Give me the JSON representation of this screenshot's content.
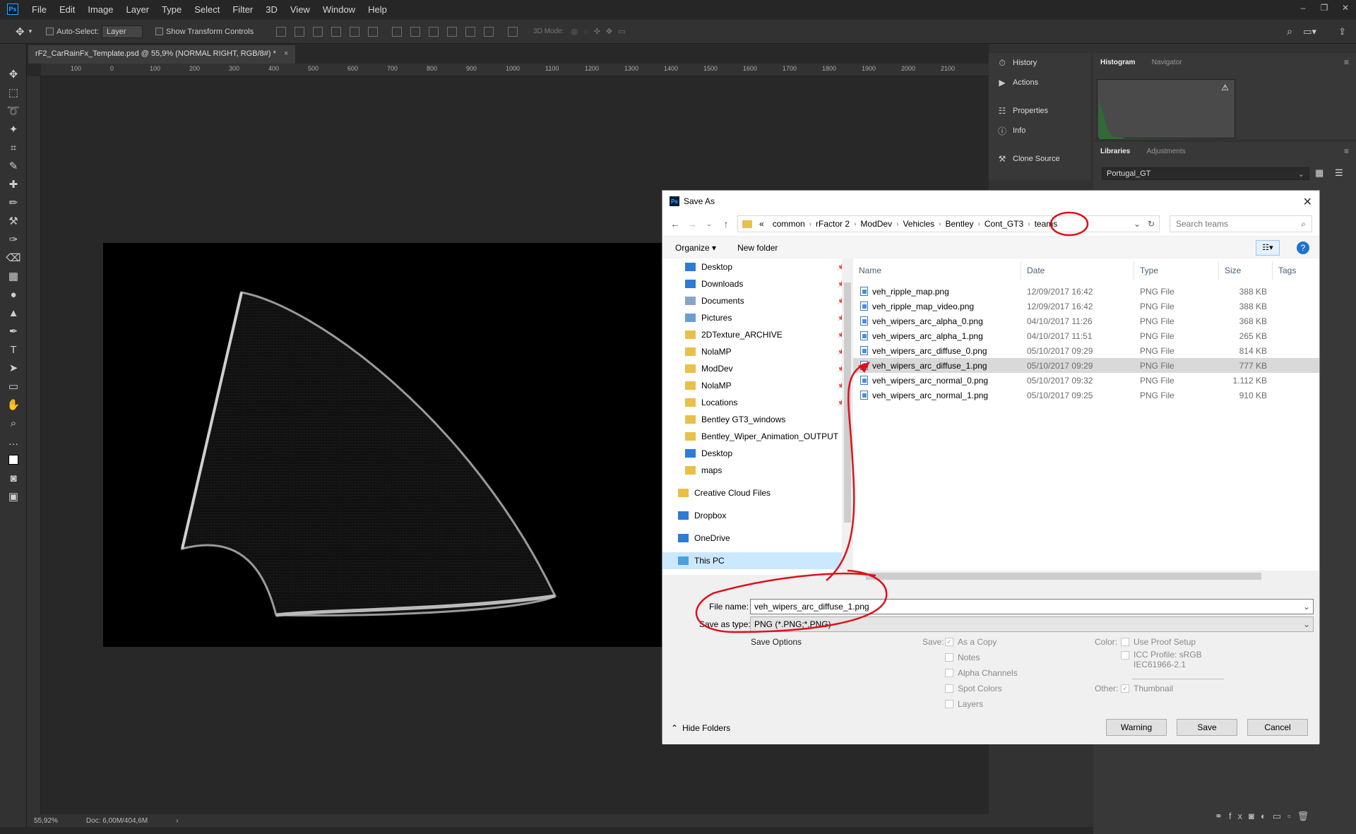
{
  "app": {
    "menu": [
      "File",
      "Edit",
      "Image",
      "Layer",
      "Type",
      "Select",
      "Filter",
      "3D",
      "View",
      "Window",
      "Help"
    ],
    "window_controls": [
      "–",
      "❐",
      "✕"
    ]
  },
  "options_bar": {
    "auto_select_label": "Auto-Select:",
    "auto_select_value": "Layer",
    "show_transform_label": "Show Transform Controls",
    "mode_3d_label": "3D Mode:"
  },
  "document": {
    "tab_title": "rF2_CarRainFx_Template.psd @ 55,9% (NORMAL RIGHT, RGB/8#) *",
    "ruler_labels": [
      "100",
      "0",
      "100",
      "200",
      "300",
      "400",
      "500",
      "600",
      "700",
      "800",
      "900",
      "1000",
      "1100",
      "1200",
      "1300",
      "1400",
      "1500",
      "1600",
      "1700",
      "1800",
      "1900",
      "2000",
      "2100"
    ],
    "zoom": "55,92%",
    "doc_size": "Doc: 6,00M/404,6M"
  },
  "panels": {
    "collapsed": [
      "History",
      "Actions",
      "Properties",
      "Info",
      "Clone Source"
    ],
    "histogram_tabs": [
      "Histogram",
      "Navigator"
    ],
    "library_tabs": [
      "Libraries",
      "Adjustments"
    ],
    "library_select": "Portugal_GT"
  },
  "dialog": {
    "title": "Save As",
    "breadcrumb": [
      "«",
      "common",
      "rFactor 2",
      "ModDev",
      "Vehicles",
      "Bentley",
      "Cont_GT3",
      "teams"
    ],
    "search_placeholder": "Search teams",
    "organize": "Organize ▾",
    "new_folder": "New folder",
    "nav_items": [
      {
        "label": "Desktop",
        "icon": "desktop",
        "pinned": true
      },
      {
        "label": "Downloads",
        "icon": "download",
        "pinned": true
      },
      {
        "label": "Documents",
        "icon": "document",
        "pinned": true
      },
      {
        "label": "Pictures",
        "icon": "picture",
        "pinned": true
      },
      {
        "label": "2DTexture_ARCHIVE",
        "icon": "folder",
        "pinned": true
      },
      {
        "label": "NolaMP",
        "icon": "folder",
        "pinned": true
      },
      {
        "label": "ModDev",
        "icon": "folder",
        "pinned": true
      },
      {
        "label": "NolaMP",
        "icon": "folder",
        "pinned": true
      },
      {
        "label": "Locations",
        "icon": "folder",
        "pinned": true
      },
      {
        "label": "Bentley GT3_windows",
        "icon": "folder",
        "pinned": false
      },
      {
        "label": "Bentley_Wiper_Animation_OUTPUT",
        "icon": "folder",
        "pinned": false
      },
      {
        "label": "Desktop",
        "icon": "desktop",
        "pinned": false
      },
      {
        "label": "maps",
        "icon": "folder",
        "pinned": false
      }
    ],
    "nav_roots": [
      "Creative Cloud Files",
      "Dropbox",
      "OneDrive",
      "This PC"
    ],
    "columns": [
      "Name",
      "Date",
      "Type",
      "Size",
      "Tags"
    ],
    "files": [
      {
        "name": "veh_ripple_map.png",
        "date": "12/09/2017 16:42",
        "type": "PNG File",
        "size": "388 KB"
      },
      {
        "name": "veh_ripple_map_video.png",
        "date": "12/09/2017 16:42",
        "type": "PNG File",
        "size": "388 KB"
      },
      {
        "name": "veh_wipers_arc_alpha_0.png",
        "date": "04/10/2017 11:26",
        "type": "PNG File",
        "size": "368 KB"
      },
      {
        "name": "veh_wipers_arc_alpha_1.png",
        "date": "04/10/2017 11:51",
        "type": "PNG File",
        "size": "265 KB"
      },
      {
        "name": "veh_wipers_arc_diffuse_0.png",
        "date": "05/10/2017 09:29",
        "type": "PNG File",
        "size": "814 KB"
      },
      {
        "name": "veh_wipers_arc_diffuse_1.png",
        "date": "05/10/2017 09:29",
        "type": "PNG File",
        "size": "777 KB"
      },
      {
        "name": "veh_wipers_arc_normal_0.png",
        "date": "05/10/2017 09:32",
        "type": "PNG File",
        "size": "1.112 KB"
      },
      {
        "name": "veh_wipers_arc_normal_1.png",
        "date": "05/10/2017 09:25",
        "type": "PNG File",
        "size": "910 KB"
      }
    ],
    "selected_file_index": 5,
    "file_name_label": "File name:",
    "file_name_value": "veh_wipers_arc_diffuse_1.png",
    "save_type_label": "Save as type:",
    "save_type_value": "PNG (*.PNG;*.PNG)",
    "save_options_label": "Save Options",
    "save_label": "Save:",
    "save_checks": [
      {
        "label": "As a Copy",
        "checked": true
      },
      {
        "label": "Notes",
        "checked": false
      },
      {
        "label": "Alpha Channels",
        "checked": false
      },
      {
        "label": "Spot Colors",
        "checked": false
      },
      {
        "label": "Layers",
        "checked": false
      }
    ],
    "color_label": "Color:",
    "use_proof": "Use Proof Setup",
    "icc_profile": "ICC Profile:  sRGB",
    "icc_profile_2": "IEC61966-2.1",
    "other_label": "Other:",
    "thumbnail": "Thumbnail",
    "hide_folders": "Hide Folders",
    "buttons": {
      "warning": "Warning",
      "save": "Save",
      "cancel": "Cancel"
    }
  },
  "colors": {
    "annotation": "#e0101a",
    "ps_blue": "#31a8ff",
    "selection": "#d9d9d9"
  }
}
